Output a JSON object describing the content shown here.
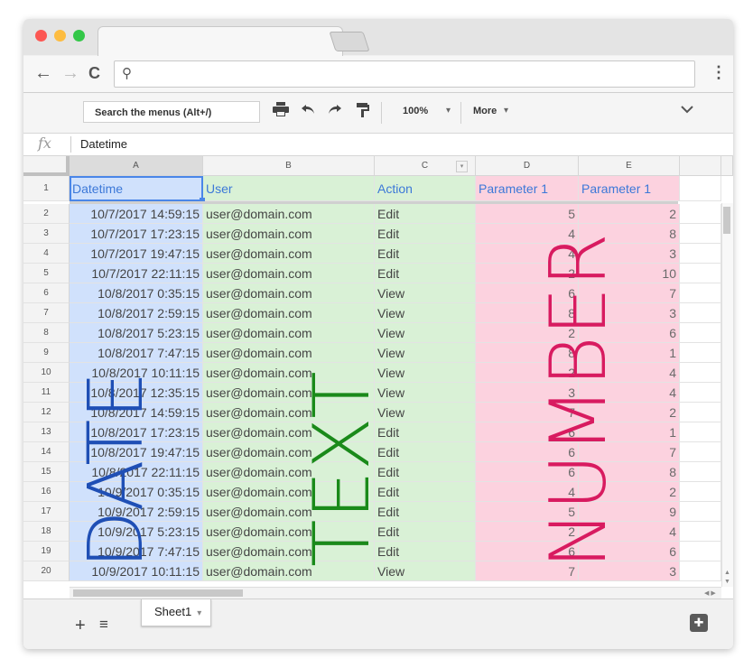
{
  "browser": {
    "nav_back": "←",
    "nav_forward": "→",
    "nav_reload": "C",
    "search_icon": "⚲",
    "menu_icon": "⋮"
  },
  "toolbar": {
    "menu_search": "Search the menus (Alt+/)",
    "zoom": "100%",
    "more": "More"
  },
  "formula": {
    "fx_label": "fx",
    "value": "Datetime"
  },
  "columns": [
    "A",
    "B",
    "C",
    "D",
    "E"
  ],
  "header_row": {
    "number": "1",
    "cells": [
      "Datetime",
      "User",
      "Action",
      "Parameter 1",
      "Parameter 1"
    ]
  },
  "rows": [
    {
      "n": "2",
      "dt": "10/7/2017 14:59:15",
      "user": "user@domain.com",
      "action": "Edit",
      "p1": "5",
      "p2": "2"
    },
    {
      "n": "3",
      "dt": "10/7/2017 17:23:15",
      "user": "user@domain.com",
      "action": "Edit",
      "p1": "4",
      "p2": "8"
    },
    {
      "n": "4",
      "dt": "10/7/2017 19:47:15",
      "user": "user@domain.com",
      "action": "Edit",
      "p1": "4",
      "p2": "3"
    },
    {
      "n": "5",
      "dt": "10/7/2017 22:11:15",
      "user": "user@domain.com",
      "action": "Edit",
      "p1": "2",
      "p2": "10"
    },
    {
      "n": "6",
      "dt": "10/8/2017 0:35:15",
      "user": "user@domain.com",
      "action": "View",
      "p1": "6",
      "p2": "7"
    },
    {
      "n": "7",
      "dt": "10/8/2017 2:59:15",
      "user": "user@domain.com",
      "action": "View",
      "p1": "8",
      "p2": "3"
    },
    {
      "n": "8",
      "dt": "10/8/2017 5:23:15",
      "user": "user@domain.com",
      "action": "View",
      "p1": "2",
      "p2": "6"
    },
    {
      "n": "9",
      "dt": "10/8/2017 7:47:15",
      "user": "user@domain.com",
      "action": "View",
      "p1": "8",
      "p2": "1"
    },
    {
      "n": "10",
      "dt": "10/8/2017 10:11:15",
      "user": "user@domain.com",
      "action": "View",
      "p1": "2",
      "p2": "4"
    },
    {
      "n": "11",
      "dt": "10/8/2017 12:35:15",
      "user": "user@domain.com",
      "action": "View",
      "p1": "3",
      "p2": "4"
    },
    {
      "n": "12",
      "dt": "10/8/2017 14:59:15",
      "user": "user@domain.com",
      "action": "View",
      "p1": "7",
      "p2": "2"
    },
    {
      "n": "13",
      "dt": "10/8/2017 17:23:15",
      "user": "user@domain.com",
      "action": "Edit",
      "p1": "6",
      "p2": "1"
    },
    {
      "n": "14",
      "dt": "10/8/2017 19:47:15",
      "user": "user@domain.com",
      "action": "Edit",
      "p1": "6",
      "p2": "7"
    },
    {
      "n": "15",
      "dt": "10/8/2017 22:11:15",
      "user": "user@domain.com",
      "action": "Edit",
      "p1": "6",
      "p2": "8"
    },
    {
      "n": "16",
      "dt": "10/9/2017 0:35:15",
      "user": "user@domain.com",
      "action": "Edit",
      "p1": "4",
      "p2": "2"
    },
    {
      "n": "17",
      "dt": "10/9/2017 2:59:15",
      "user": "user@domain.com",
      "action": "Edit",
      "p1": "5",
      "p2": "9"
    },
    {
      "n": "18",
      "dt": "10/9/2017 5:23:15",
      "user": "user@domain.com",
      "action": "Edit",
      "p1": "2",
      "p2": "4"
    },
    {
      "n": "19",
      "dt": "10/9/2017 7:47:15",
      "user": "user@domain.com",
      "action": "Edit",
      "p1": "6",
      "p2": "6"
    },
    {
      "n": "20",
      "dt": "10/9/2017 10:11:15",
      "user": "user@domain.com",
      "action": "View",
      "p1": "7",
      "p2": "3"
    }
  ],
  "sheet": {
    "tab_name": "Sheet1",
    "add_icon": "+",
    "list_icon": "≡",
    "explore_icon": "✚"
  },
  "overlays": {
    "date": {
      "text": "DATE",
      "color": "#1f4fb5"
    },
    "text": {
      "text": "TEXT",
      "color": "#1a8a1a"
    },
    "number": {
      "text": "NUMBER",
      "color": "#d81b60"
    }
  },
  "colors": {
    "date_fill": "#d0e1fc",
    "text_fill": "#d9f1d6",
    "number_fill": "#fcd2df",
    "selection": "#4a86e8"
  },
  "icons": [
    "print-icon",
    "undo-icon",
    "redo-icon",
    "paint-format-icon",
    "chevron-down-icon"
  ]
}
